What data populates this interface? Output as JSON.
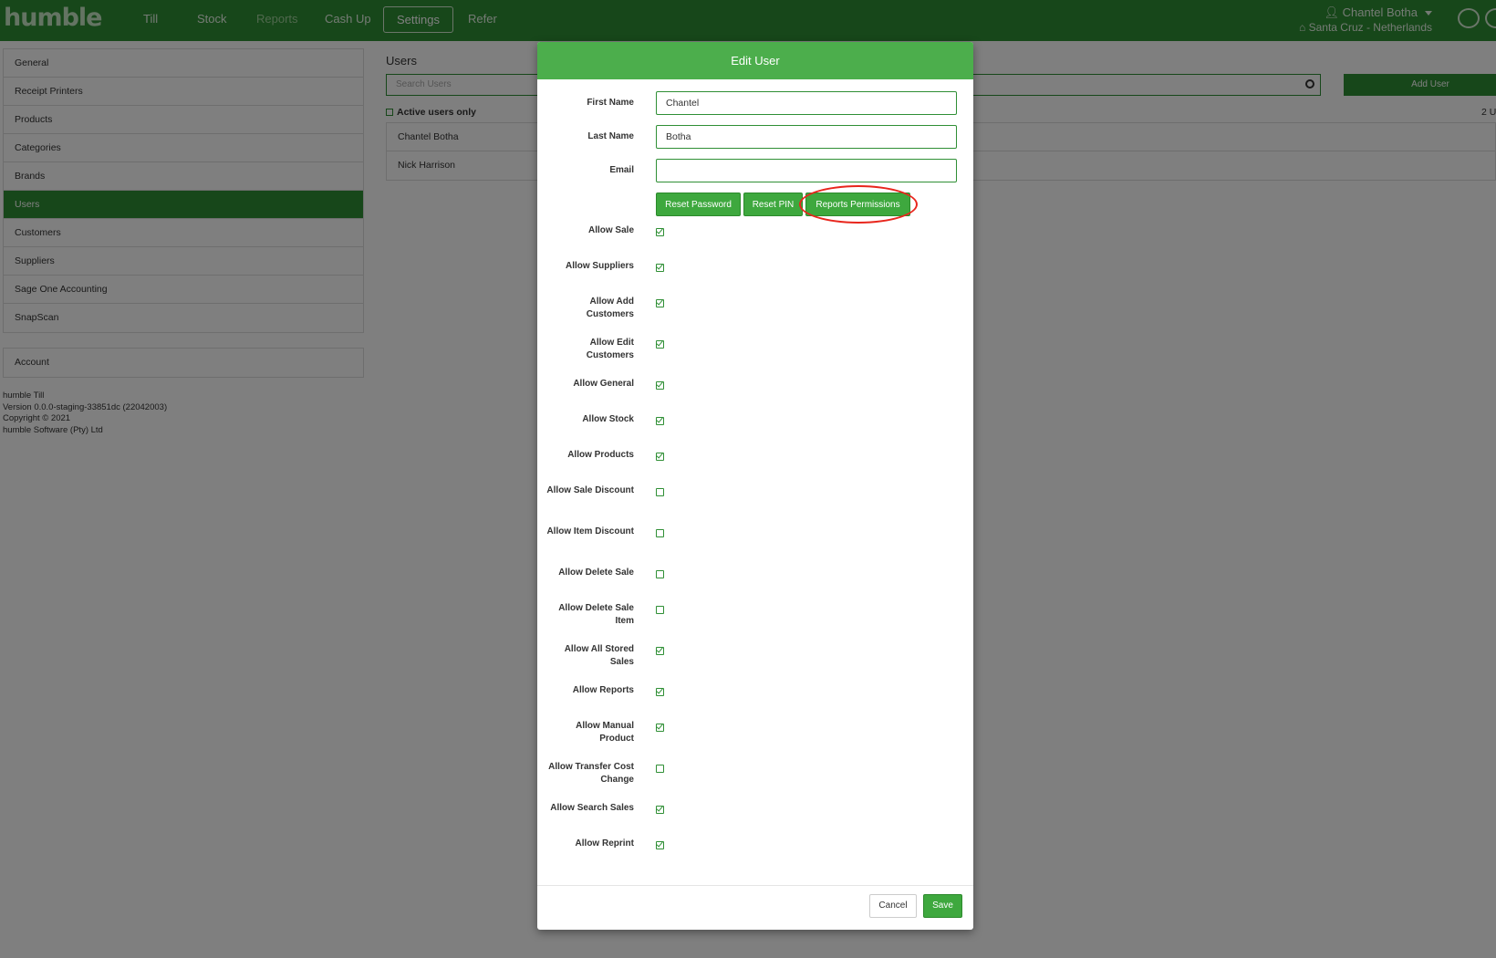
{
  "header": {
    "logo": "humble",
    "nav": [
      "Till",
      "Stock",
      "Reports",
      "Cash Up",
      "Settings",
      "Refer"
    ],
    "user_name": "Chantel Botha",
    "location": "Santa Cruz - Netherlands"
  },
  "sidebar": {
    "items": [
      "General",
      "Receipt Printers",
      "Products",
      "Categories",
      "Brands",
      "Users",
      "Customers",
      "Suppliers",
      "Sage One Accounting",
      "SnapScan"
    ],
    "account": "Account",
    "version": [
      "humble Till",
      "Version 0.0.0-staging-33851dc (22042003)",
      "Copyright © 2021",
      "humble Software (Pty) Ltd"
    ]
  },
  "main": {
    "title": "Users",
    "search_placeholder": "Search Users",
    "add_user": "Add User",
    "active_only": "Active users only",
    "count": "2 U",
    "users": [
      "Chantel Botha",
      "Nick Harrison"
    ]
  },
  "modal": {
    "title": "Edit User",
    "first_name_label": "First Name",
    "first_name": "Chantel",
    "last_name_label": "Last Name",
    "last_name": "Botha",
    "email_label": "Email",
    "email": "",
    "reset_password": "Reset Password",
    "reset_pin": "Reset PIN",
    "reports_permissions": "Reports Permissions",
    "permissions": [
      {
        "label": "Allow Sale",
        "checked": true
      },
      {
        "label": "Allow Suppliers",
        "checked": true
      },
      {
        "label": "Allow Add Customers",
        "checked": true
      },
      {
        "label": "Allow Edit Customers",
        "checked": true
      },
      {
        "label": "Allow General",
        "checked": true
      },
      {
        "label": "Allow Stock",
        "checked": true
      },
      {
        "label": "Allow Products",
        "checked": true
      },
      {
        "label": "Allow Sale Discount",
        "checked": false
      },
      {
        "label": "Allow Item Discount",
        "checked": false
      },
      {
        "label": "Allow Delete Sale",
        "checked": false
      },
      {
        "label": "Allow Delete Sale Item",
        "checked": false
      },
      {
        "label": "Allow All Stored Sales",
        "checked": true
      },
      {
        "label": "Allow Reports",
        "checked": true
      },
      {
        "label": "Allow Manual Product",
        "checked": true
      },
      {
        "label": "Allow Transfer Cost Change",
        "checked": false
      },
      {
        "label": "Allow Search Sales",
        "checked": true
      },
      {
        "label": "Allow Reprint",
        "checked": true
      }
    ],
    "cancel": "Cancel",
    "save": "Save"
  },
  "colors": {
    "brand_green": "#2f8f35",
    "modal_header_green": "#4cae4c",
    "highlight_red": "#e8261d"
  }
}
